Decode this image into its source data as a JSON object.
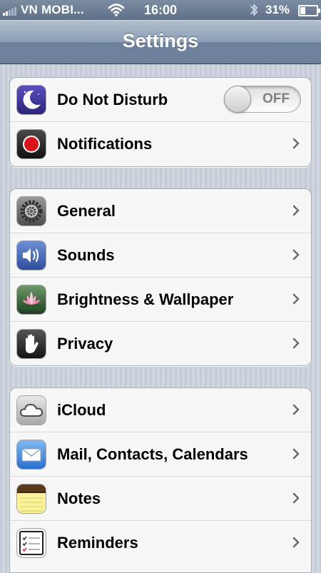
{
  "status_bar": {
    "carrier": "VN MOBI...",
    "time": "16:00",
    "battery_text": "31%",
    "battery_level": 0.31,
    "signal_bars_filled": 2,
    "signal_bars_total": 5
  },
  "nav": {
    "title": "Settings"
  },
  "groups": [
    {
      "rows": [
        {
          "label": "Do Not Disturb",
          "icon": "moon-icon",
          "toggle": "OFF"
        },
        {
          "label": "Notifications",
          "icon": "notifications-icon"
        }
      ]
    },
    {
      "rows": [
        {
          "label": "General",
          "icon": "gear-icon"
        },
        {
          "label": "Sounds",
          "icon": "speaker-icon"
        },
        {
          "label": "Brightness & Wallpaper",
          "icon": "flower-icon"
        },
        {
          "label": "Privacy",
          "icon": "hand-icon"
        }
      ]
    },
    {
      "rows": [
        {
          "label": "iCloud",
          "icon": "cloud-icon"
        },
        {
          "label": "Mail, Contacts, Calendars",
          "icon": "mail-icon"
        },
        {
          "label": "Notes",
          "icon": "notes-icon"
        },
        {
          "label": "Reminders",
          "icon": "reminders-icon"
        }
      ]
    }
  ],
  "colors": {
    "nav_bar": "#7a8ca5",
    "background": "#cbd2db",
    "row_text": "#000000",
    "toggle_off_text": "#7f7f7f"
  }
}
